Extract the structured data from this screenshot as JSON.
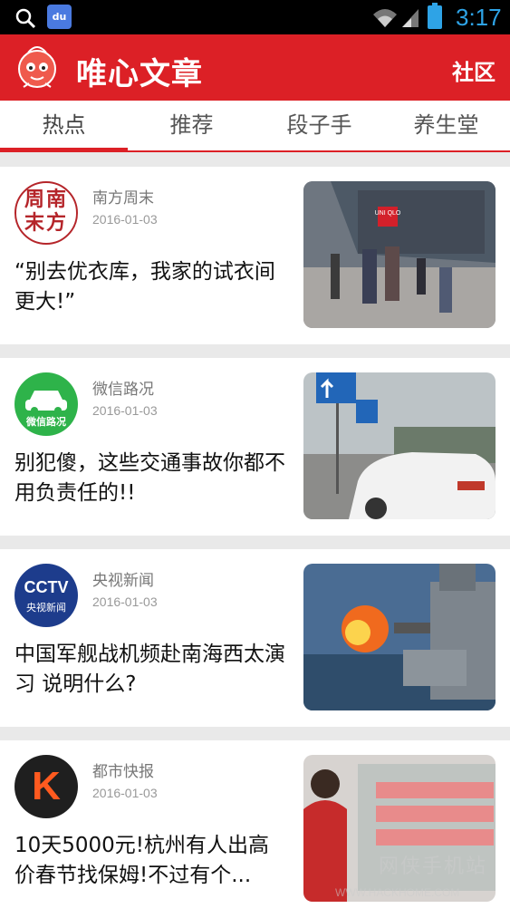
{
  "status_bar": {
    "time": "3:17",
    "colors": {
      "time": "#2ea3e6"
    }
  },
  "app_bar": {
    "title": "唯心文章",
    "community_label": "社区",
    "colors": {
      "background": "#dc2026"
    }
  },
  "tabs": [
    {
      "label": "热点",
      "active": true
    },
    {
      "label": "推荐",
      "active": false
    },
    {
      "label": "段子手",
      "active": false
    },
    {
      "label": "养生堂",
      "active": false
    }
  ],
  "feed": [
    {
      "source": "南方周末",
      "date": "2016-01-03",
      "headline": "“别去优衣库，我家的试衣间更大!”",
      "avatar_text": "周南末方",
      "thumb_sign": "UNI QLO"
    },
    {
      "source": "微信路况",
      "date": "2016-01-03",
      "headline": "别犯傻，这些交通事故你都不用负责任的!!",
      "avatar_text": "微信路况"
    },
    {
      "source": "央视新闻",
      "date": "2016-01-03",
      "headline": "中国军舰战机频赴南海西太演习 说明什么?",
      "avatar_text": "CCTV",
      "avatar_subtext": "央视新闻"
    },
    {
      "source": "都市快报",
      "date": "2016-01-03",
      "headline": "10天5000元!杭州有人出高价春节找保姆!不过有个...",
      "avatar_text": "K"
    }
  ],
  "watermark": {
    "text": "网侠手机站",
    "url": "WWW.HACKHOME.COM"
  }
}
